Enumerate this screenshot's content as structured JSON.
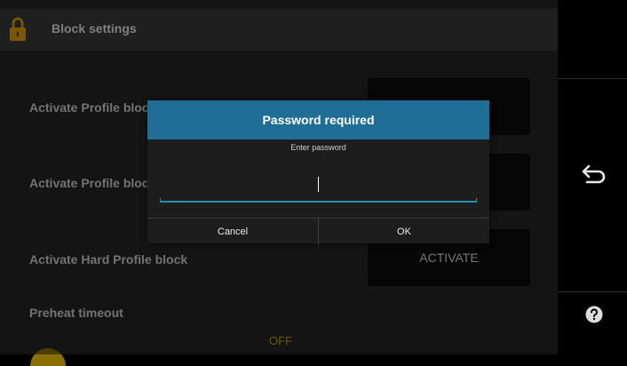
{
  "header": {
    "title": "Block settings",
    "icon": "lock-icon"
  },
  "settings": [
    {
      "label": "Activate Profile block"
    },
    {
      "label": "Activate Profile block"
    },
    {
      "label": "Activate Hard Profile block",
      "button": "ACTIVATE"
    }
  ],
  "preheat": {
    "label": "Preheat timeout",
    "value": "OFF"
  },
  "sidebar": {
    "back_icon": "back-arrow-icon",
    "help_icon": "help-icon"
  },
  "dialog": {
    "title": "Password required",
    "subtitle": "Enter password",
    "input_value": "",
    "cancel": "Cancel",
    "ok": "OK"
  },
  "colors": {
    "dialog_title_bg": "#1e6e96",
    "input_underline": "#2a8fb8",
    "off_text": "#c5a000",
    "lock_icon": "#e0a000"
  }
}
